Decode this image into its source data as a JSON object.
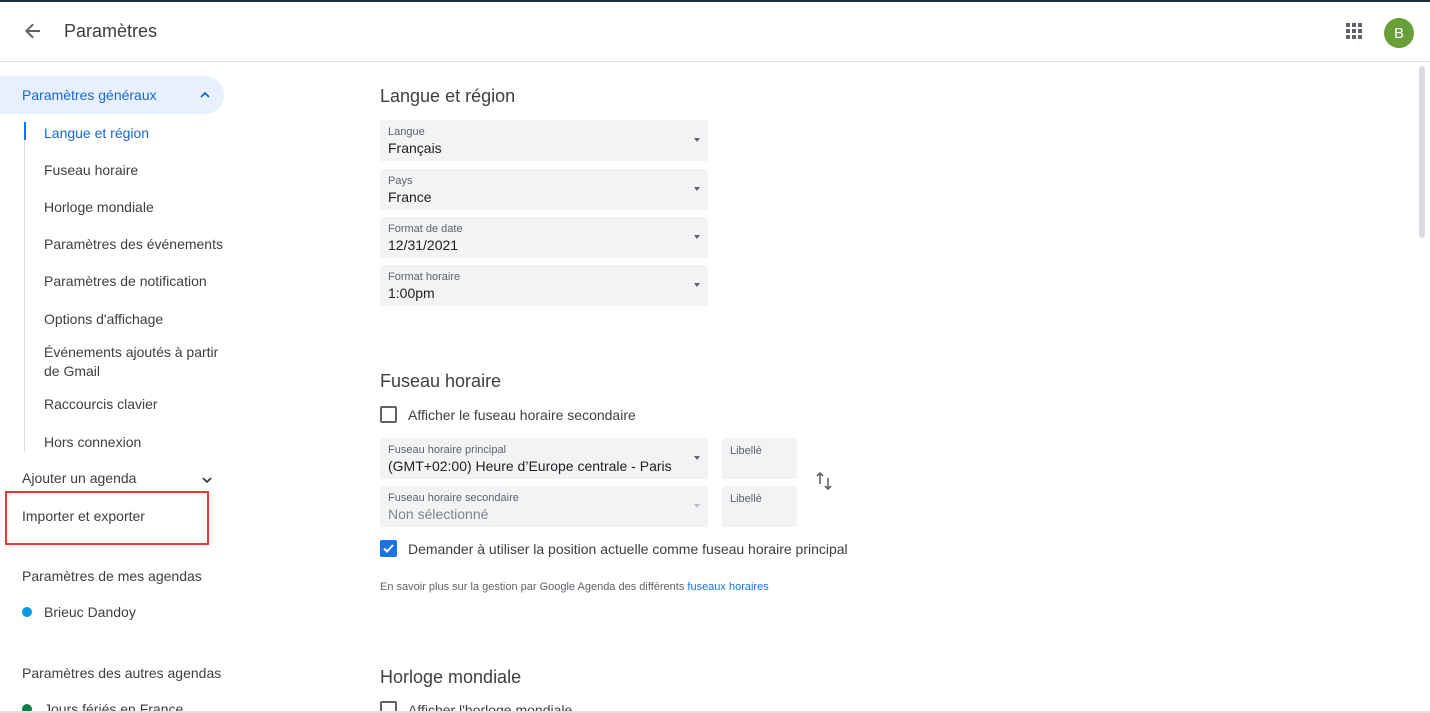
{
  "header": {
    "title": "Paramètres",
    "back_icon": "arrow-back-icon",
    "apps_icon": "apps-grid-icon",
    "avatar_letter": "B",
    "avatar_color": "#689f38"
  },
  "sidebar": {
    "general_label": "Paramètres généraux",
    "general_items": [
      "Langue et région",
      "Fuseau horaire",
      "Horloge mondiale",
      "Paramètres des événements",
      "Paramètres de notification",
      "Options d'affichage",
      "Événements ajoutés à partir de Gmail",
      "Raccourcis clavier",
      "Hors connexion"
    ],
    "add_calendar": "Ajouter un agenda",
    "import_export": "Importer et exporter",
    "my_calendars_heading": "Paramètres de mes agendas",
    "my_calendars": [
      {
        "name": "Brieuc Dandoy",
        "color": "#039be5"
      }
    ],
    "other_calendars_heading": "Paramètres des autres agendas",
    "other_calendars": [
      {
        "name": "Jours fériés en France",
        "color": "#0b8043"
      }
    ],
    "accent_color": "#1967d2",
    "highlight_color": "#e53935"
  },
  "main": {
    "lang_region": {
      "title": "Langue et région",
      "fields": [
        {
          "label": "Langue",
          "value": "Français"
        },
        {
          "label": "Pays",
          "value": "France"
        },
        {
          "label": "Format de date",
          "value": "12/31/2021"
        },
        {
          "label": "Format horaire",
          "value": "1:00pm"
        }
      ]
    },
    "timezone": {
      "title": "Fuseau horaire",
      "show_secondary_label": "Afficher le fuseau horaire secondaire",
      "show_secondary_checked": false,
      "primary_label": "Fuseau horaire principal",
      "primary_value": "(GMT+02:00) Heure d’Europe centrale - Paris",
      "secondary_label": "Fuseau horaire secondaire",
      "secondary_value": "Non sélectionné",
      "libelle_placeholder": "Libellé",
      "ask_location_label": "Demander à utiliser la position actuelle comme fuseau horaire principal",
      "ask_location_checked": true,
      "help_text": "En savoir plus sur la gestion par Google Agenda des différents ",
      "help_link": "fuseaux horaires"
    },
    "world_clock": {
      "title": "Horloge mondiale",
      "show_label": "Afficher l'horloge mondiale"
    }
  }
}
